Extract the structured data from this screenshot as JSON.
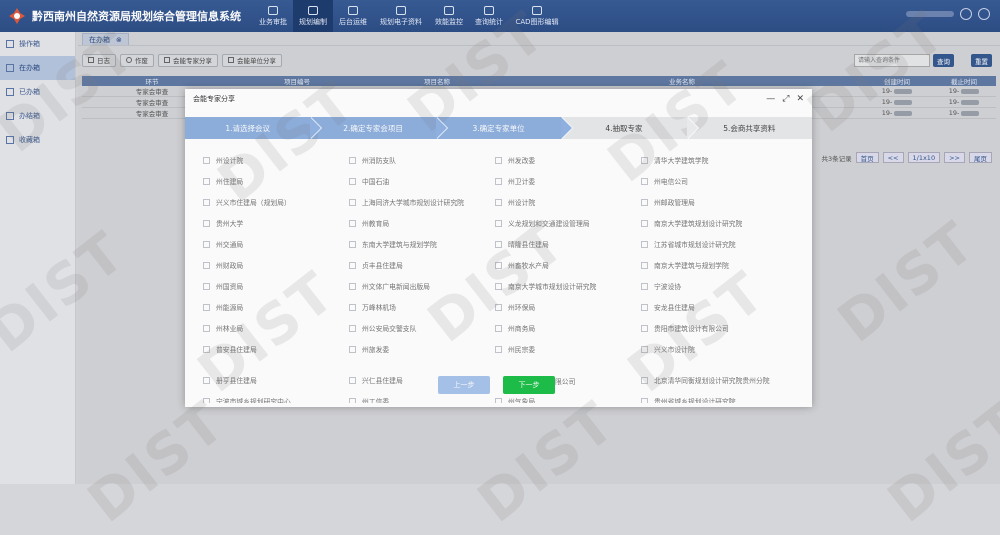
{
  "app": {
    "title": "黔西南州自然资源局规划综合管理信息系统"
  },
  "nav": [
    {
      "label": "业务审批",
      "icon": "document-icon"
    },
    {
      "label": "规划编制",
      "icon": "edit-icon"
    },
    {
      "label": "后台运维",
      "icon": "tools-icon"
    },
    {
      "label": "规划电子资料",
      "icon": "folder-icon"
    },
    {
      "label": "效能监控",
      "icon": "monitor-icon"
    },
    {
      "label": "查询统计",
      "icon": "chart-icon"
    },
    {
      "label": "CAD图形编辑",
      "icon": "cad-icon"
    }
  ],
  "sidebar": [
    {
      "label": "操作箱"
    },
    {
      "label": "在办箱"
    },
    {
      "label": "已办箱"
    },
    {
      "label": "办结箱"
    },
    {
      "label": "收藏箱"
    }
  ],
  "tab": {
    "label": "在办箱",
    "close": "⊗"
  },
  "toolbar": {
    "log": "日志",
    "void": "作废",
    "share_expert": "会能专家分享",
    "share_unit": "会能单位分享"
  },
  "search": {
    "placeholder": "请输入查询条件",
    "query": "查询",
    "reset": "重置"
  },
  "table": {
    "headers": [
      "环节",
      "项目编号",
      "项目名称",
      "业务名称",
      "创建时间",
      "截止时间"
    ],
    "rows": [
      {
        "step": "专家会审查",
        "created": "19-",
        "deadline": "19-"
      },
      {
        "step": "专家会审查",
        "created": "19-",
        "deadline": "19-"
      },
      {
        "step": "专家会审查",
        "created": "19-",
        "deadline": "19-"
      }
    ]
  },
  "pager": {
    "total": "共3条记录",
    "first": "首页",
    "prev": "<<",
    "page": "1/1x10",
    "next": ">>",
    "last": "尾页"
  },
  "modal": {
    "title": "会能专家分享",
    "minimize": "—",
    "maximize": "⤢",
    "close": "✕",
    "steps": [
      "1.请选择会议",
      "2.确定专家会项目",
      "3.确定专家单位",
      "4.抽取专家",
      "5.会商共享资料"
    ],
    "options": [
      [
        "州设计院",
        "州消防支队",
        "州发改委",
        "清华大学建筑学院"
      ],
      [
        "州住建局",
        "中国石油",
        "州卫计委",
        "州电信公司"
      ],
      [
        "兴义市住建局（规划局）",
        "上海同济大学城市规划设计研究院",
        "州设计院",
        "州邮政管理局"
      ],
      [
        "贵州大学",
        "州教育局",
        "义龙规划和交通建设管理局",
        "南京大学建筑规划设计研究院"
      ],
      [
        "州交通局",
        "东南大学建筑与规划学院",
        "晴隆县住建局",
        "江苏省城市规划设计研究院"
      ],
      [
        "州财政局",
        "贞丰县住建局",
        "州畜牧水产局",
        "南京大学建筑与规划学院"
      ],
      [
        "州国资局",
        "州文体广电新闻出版局",
        "南京大学城市规划设计研究院",
        "宁波设协"
      ],
      [
        "州能源局",
        "万峰林机场",
        "州环保局",
        "安龙县住建局"
      ],
      [
        "州林业局",
        "州公安局交警支队",
        "州商务局",
        "贵阳市建筑设计有限公司"
      ],
      [
        "普安县住建局",
        "州旅发委",
        "州民宗委",
        "兴义市设计院"
      ],
      [
        "册亨县住建局",
        "兴仁县住建局",
        "",
        "北京清华同衡规划设计研究院贵州分院"
      ],
      [
        "宁波市城乡规划研究中心",
        "州工信委",
        "州气象局",
        "贵州省城乡规划设计研究院"
      ]
    ],
    "partial": "限公司",
    "prev": "上一步",
    "next": "下一步"
  },
  "watermark": "DIST"
}
